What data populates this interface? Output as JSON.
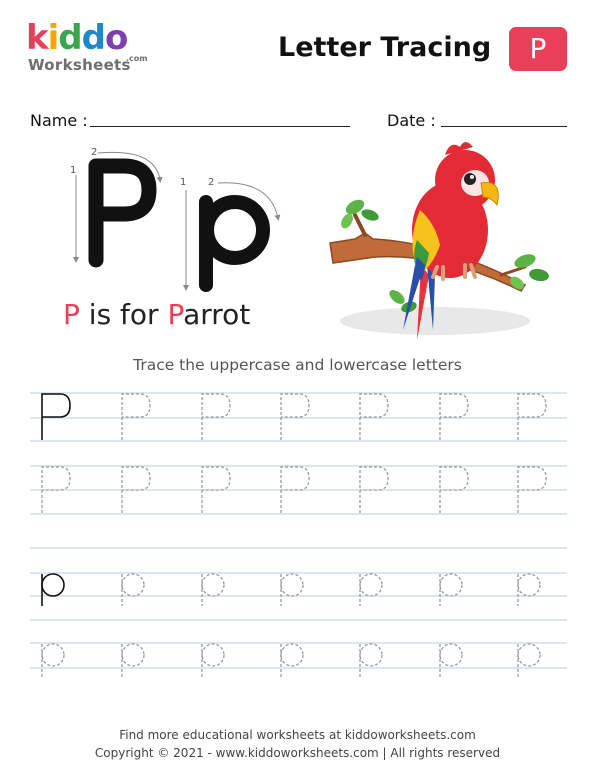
{
  "header": {
    "logo_main": "kiddo",
    "logo_sub": "Worksheets",
    "logo_com": ".com",
    "title": "Letter Tracing",
    "letter_badge": "P"
  },
  "form": {
    "name_label": "Name :",
    "date_label": "Date :"
  },
  "demo": {
    "stroke_number_1": "1",
    "stroke_number_2": "2",
    "caption_letter_1": "P",
    "caption_middle": " is for ",
    "caption_letter_2": "P",
    "caption_end": "arrot"
  },
  "instruction": "Trace the uppercase and lowercase letters",
  "footer": {
    "line1": "Find more educational worksheets at kiddoworksheets.com",
    "line2": "Copyright © 2021 - www.kiddoworksheets.com  |  All rights reserved"
  },
  "colors": {
    "accent": "#e83f5b",
    "guide_line": "#b9cbe0",
    "dashed_letter": "#9a9a9a",
    "logo_k": "#e83f5b",
    "logo_i": "#f7a600",
    "logo_d1": "#3aa64a",
    "logo_d2": "#1e88c8",
    "logo_o": "#7b3fb0"
  }
}
